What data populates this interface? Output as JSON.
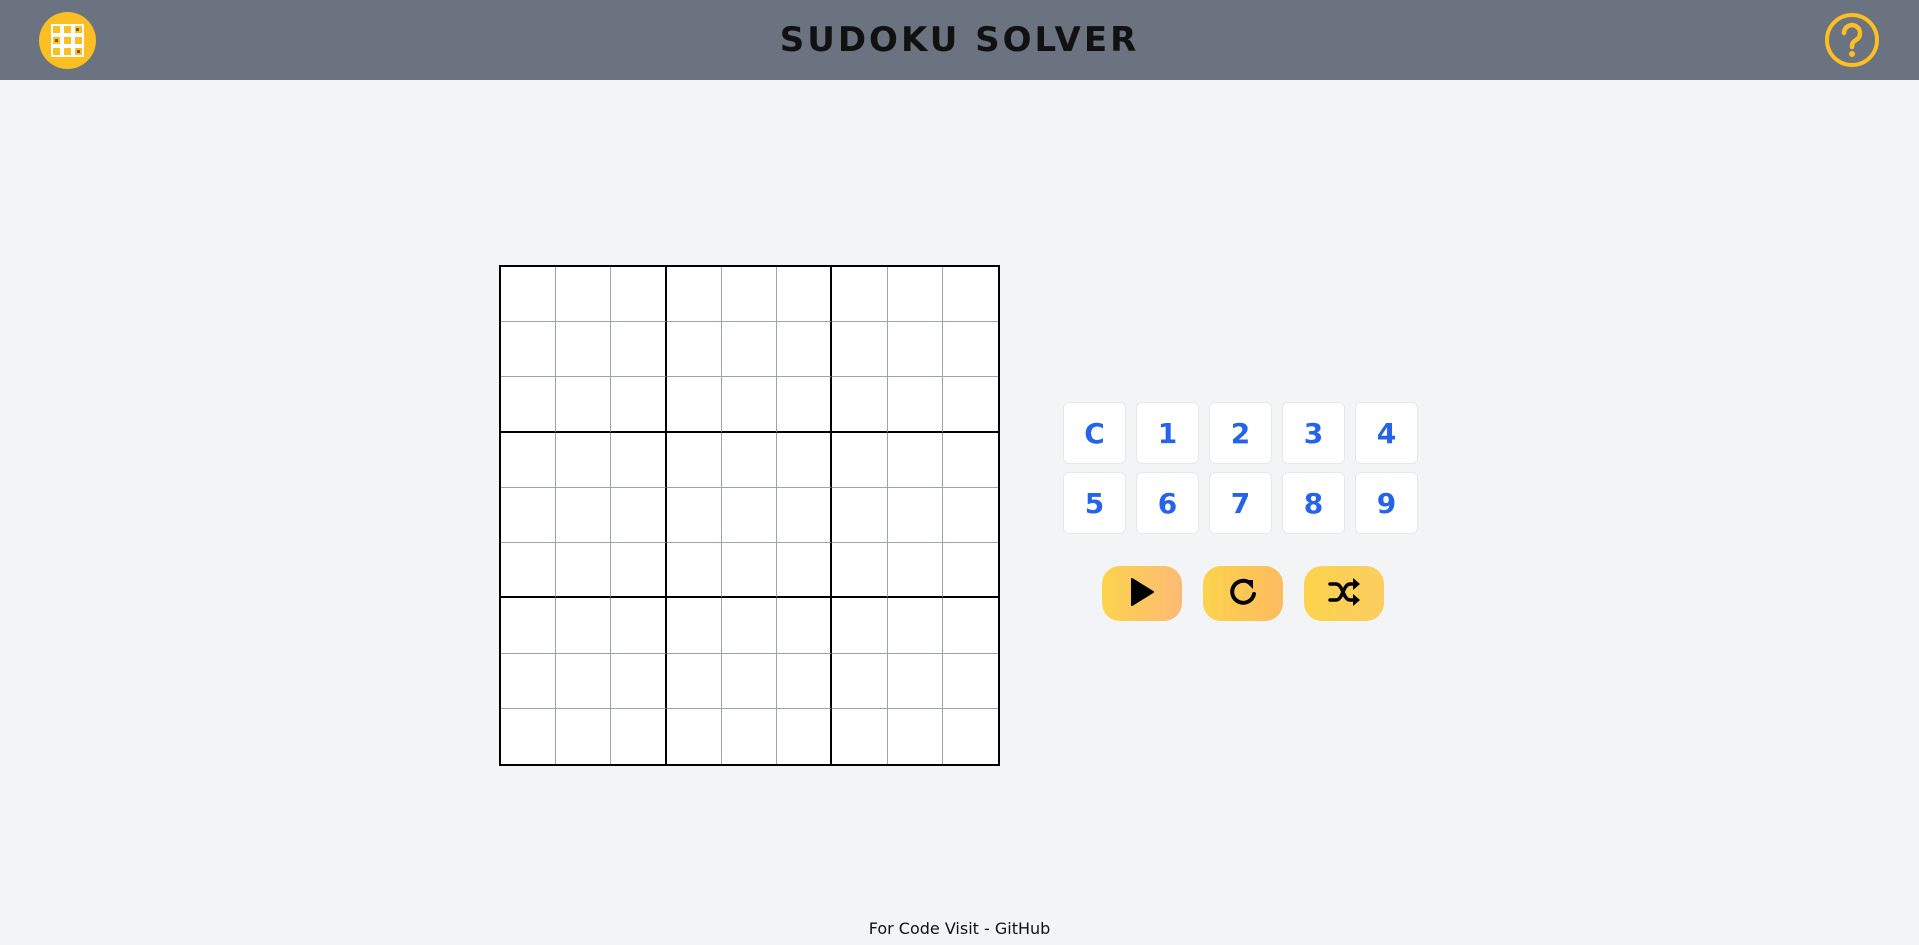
{
  "header": {
    "title": "SUDOKU SOLVER",
    "logo_icon": "sudoku-grid-logo-icon",
    "help_icon": "question-circle-icon",
    "background": "#6b7280",
    "accent": "#fbbf24"
  },
  "board": {
    "size": 9,
    "cells": [
      [
        "",
        "",
        "",
        "",
        "",
        "",
        "",
        "",
        ""
      ],
      [
        "",
        "",
        "",
        "",
        "",
        "",
        "",
        "",
        ""
      ],
      [
        "",
        "",
        "",
        "",
        "",
        "",
        "",
        "",
        ""
      ],
      [
        "",
        "",
        "",
        "",
        "",
        "",
        "",
        "",
        ""
      ],
      [
        "",
        "",
        "",
        "",
        "",
        "",
        "",
        "",
        ""
      ],
      [
        "",
        "",
        "",
        "",
        "",
        "",
        "",
        "",
        ""
      ],
      [
        "",
        "",
        "",
        "",
        "",
        "",
        "",
        "",
        ""
      ],
      [
        "",
        "",
        "",
        "",
        "",
        "",
        "",
        "",
        ""
      ],
      [
        "",
        "",
        "",
        "",
        "",
        "",
        "",
        "",
        ""
      ]
    ]
  },
  "keypad": {
    "keys": [
      "C",
      "1",
      "2",
      "3",
      "4",
      "5",
      "6",
      "7",
      "8",
      "9"
    ],
    "key_color": "#2563eb"
  },
  "actions": [
    {
      "icon": "play-icon"
    },
    {
      "icon": "refresh-icon"
    },
    {
      "icon": "shuffle-icon"
    }
  ],
  "footer": {
    "text": "For Code Visit - ",
    "link": "GitHub"
  }
}
